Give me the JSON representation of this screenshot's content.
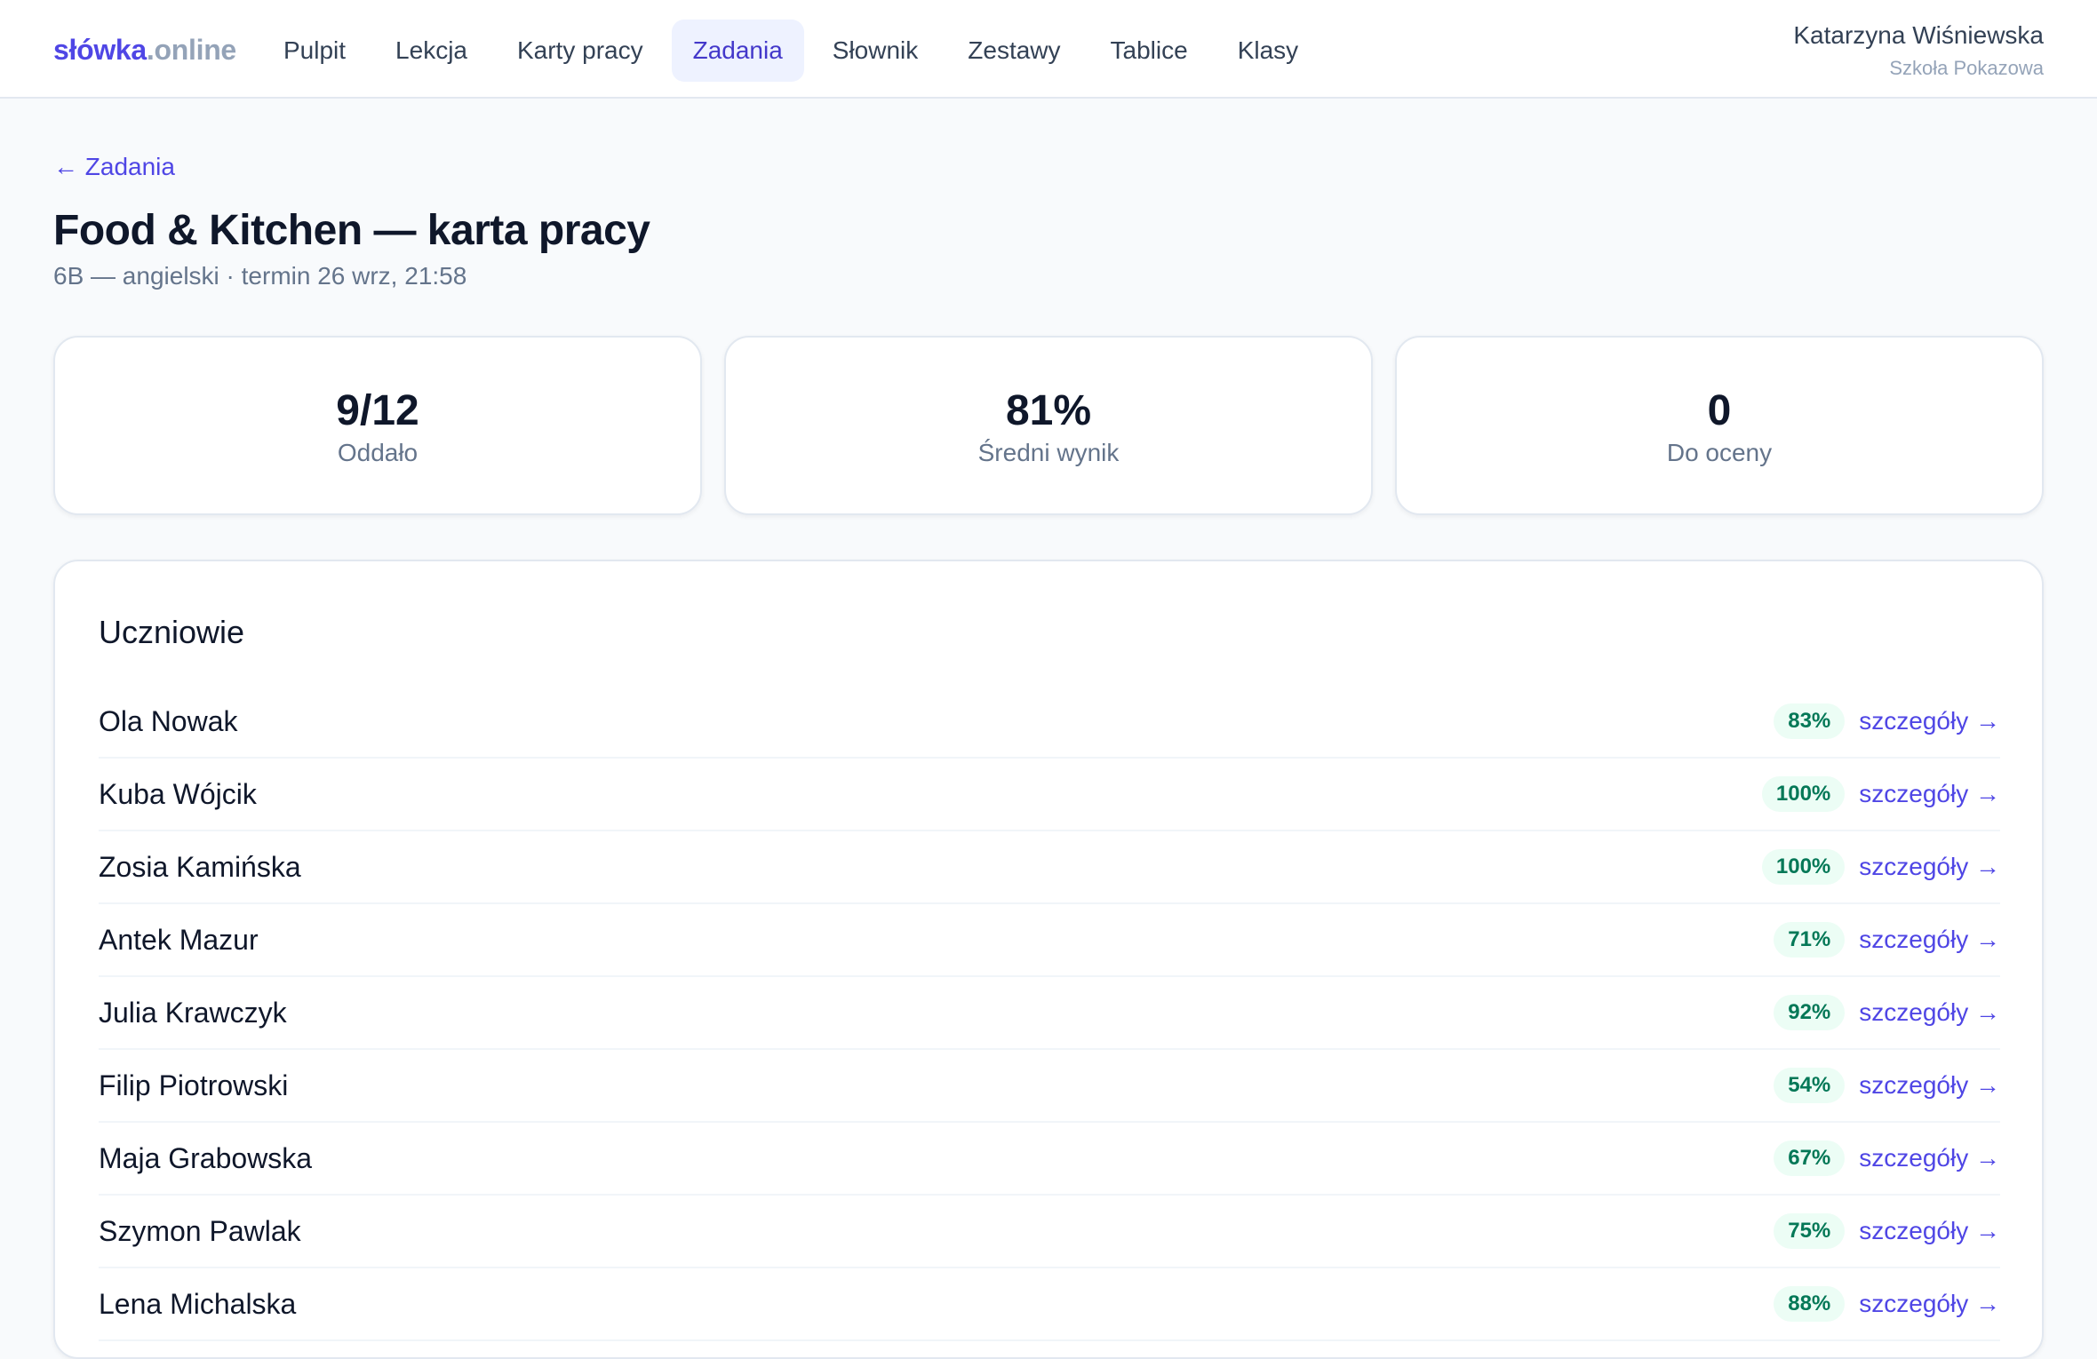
{
  "header": {
    "logo_brand": "słówka",
    "logo_tld": ".online",
    "nav": [
      {
        "label": "Pulpit"
      },
      {
        "label": "Lekcja"
      },
      {
        "label": "Karty pracy"
      },
      {
        "label": "Zadania",
        "active": true
      },
      {
        "label": "Słownik"
      },
      {
        "label": "Zestawy"
      },
      {
        "label": "Tablice"
      },
      {
        "label": "Klasy"
      }
    ],
    "user": {
      "name": "Katarzyna Wiśniewska",
      "school": "Szkoła Pokazowa"
    }
  },
  "page": {
    "back_link": "← Zadania",
    "title": "Food & Kitchen — karta pracy",
    "subtitle": "6B — angielski · termin 26 wrz, 21:58"
  },
  "stats": [
    {
      "value": "9/12",
      "label": "Oddało"
    },
    {
      "value": "81%",
      "label": "Średni wynik"
    },
    {
      "value": "0",
      "label": "Do oceny"
    }
  ],
  "students": {
    "title": "Uczniowie",
    "details_label": "szczegóły →",
    "rows": [
      {
        "name": "Ola Nowak",
        "score": "83%"
      },
      {
        "name": "Kuba Wójcik",
        "score": "100%"
      },
      {
        "name": "Zosia Kamińska",
        "score": "100%"
      },
      {
        "name": "Antek Mazur",
        "score": "71%"
      },
      {
        "name": "Julia Krawczyk",
        "score": "92%"
      },
      {
        "name": "Filip Piotrowski",
        "score": "54%"
      },
      {
        "name": "Maja Grabowska",
        "score": "67%"
      },
      {
        "name": "Szymon Pawlak",
        "score": "75%"
      },
      {
        "name": "Lena Michalska",
        "score": "88%"
      }
    ]
  },
  "colors": {
    "accent": "#4f46e5",
    "badge_bg": "#ecfdf5",
    "badge_text": "#047857"
  }
}
